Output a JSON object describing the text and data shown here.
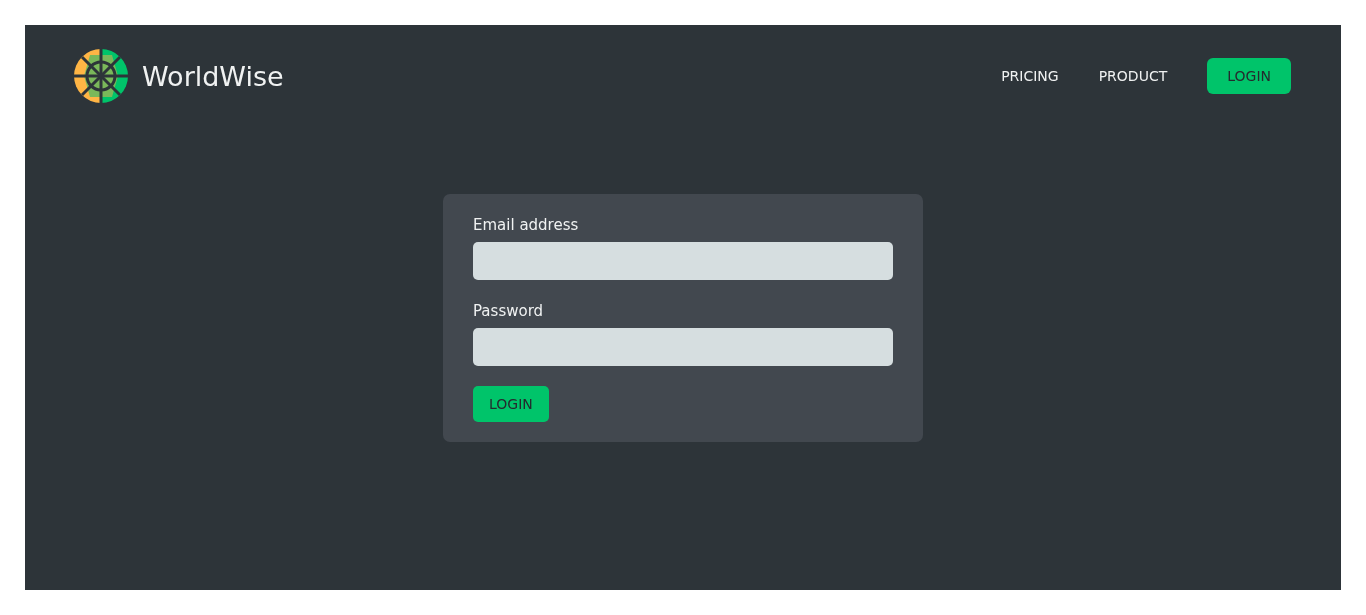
{
  "brand": {
    "name": "WorldWise"
  },
  "nav": [
    {
      "label": "PRICING",
      "kind": "link"
    },
    {
      "label": "PRODUCT",
      "kind": "link"
    },
    {
      "label": "LOGIN",
      "kind": "cta"
    }
  ],
  "form": {
    "fields": [
      {
        "label": "Email address"
      },
      {
        "label": "Password"
      }
    ],
    "submit": "LOGIN"
  }
}
